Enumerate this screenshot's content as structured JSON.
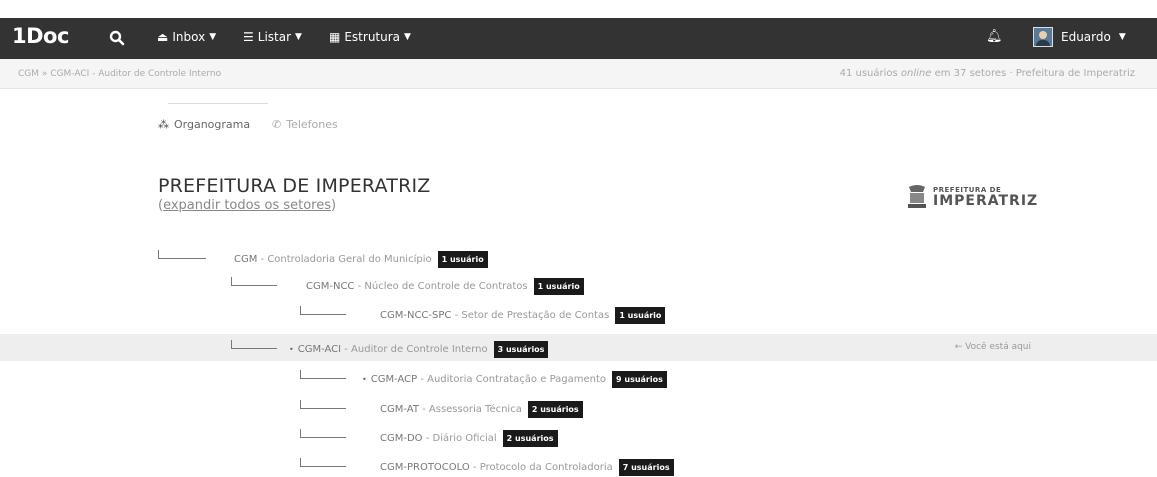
{
  "navbar": {
    "brand": "1Doc",
    "inbox": "Inbox",
    "listar": "Listar",
    "estrutura": "Estrutura",
    "user": "Eduardo",
    "bg_color": "#333333"
  },
  "breadcrumb": {
    "path": "CGM » CGM-ACI - Auditor de Controle Interno",
    "online_count": "41 usuários",
    "online_word": "online",
    "sectors": "em 37 setores",
    "org": "· Prefeitura de Imperatriz"
  },
  "tabs": {
    "organograma": "Organograma",
    "telefones": "Telefones"
  },
  "page": {
    "title": "PREFEITURA DE IMPERATRIZ",
    "expand_prefix": "(",
    "expand_link": "expandir todos os setores",
    "expand_suffix": ")"
  },
  "logo": {
    "small": "PREFEITURA DE",
    "big": "IMPERATRIZ"
  },
  "tree": [
    {
      "code": "CGM",
      "name": " - Controladoria Geral do Município",
      "badge": "1 usuário",
      "bullet": ""
    },
    {
      "code": "CGM-NCC",
      "name": " - Núcleo de Controle de Contratos",
      "badge": "1 usuário",
      "bullet": ""
    },
    {
      "code": "CGM-NCC-SPC",
      "name": " - Setor de Prestação de Contas",
      "badge": "1 usuário",
      "bullet": ""
    },
    {
      "code": "CGM-ACI",
      "name": " - Auditor de Controle Interno",
      "badge": "3 usuários",
      "bullet": "•"
    },
    {
      "code": "CGM-ACP",
      "name": " - Auditoria Contratação e Pagamento",
      "badge": "9 usuários",
      "bullet": "•"
    },
    {
      "code": "CGM-AT",
      "name": " - Assessoria Técnica",
      "badge": "2 usuários",
      "bullet": ""
    },
    {
      "code": "CGM-DO",
      "name": " - Diário Oficial",
      "badge": "2 usuários",
      "bullet": ""
    },
    {
      "code": "CGM-PROTOCOLO",
      "name": " - Protocolo da Controladoria",
      "badge": "7 usuários",
      "bullet": ""
    }
  ],
  "current_marker": "Você está aqui"
}
